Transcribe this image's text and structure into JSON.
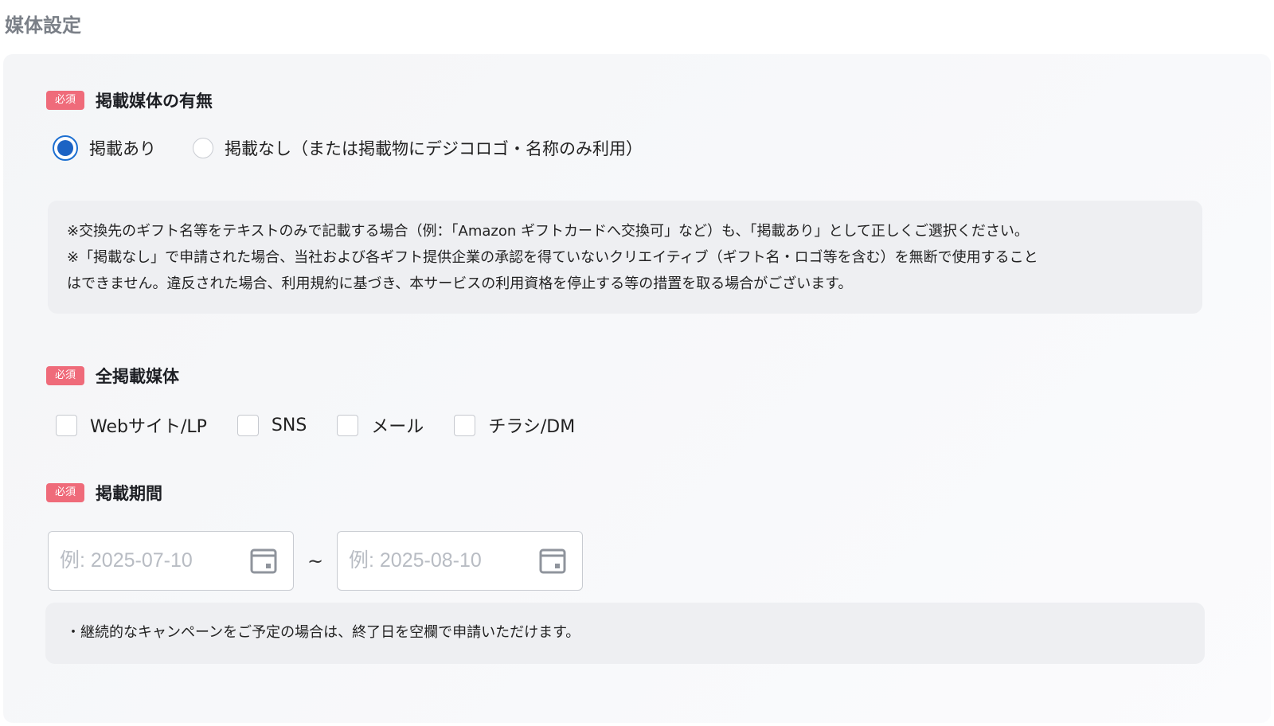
{
  "page_title": "媒体設定",
  "required_badge": "必須",
  "section_media_presence": {
    "title": "掲載媒体の有無",
    "options": [
      {
        "label": "掲載あり",
        "checked": true
      },
      {
        "label": "掲載なし（または掲載物にデジコロゴ・名称のみ利用）",
        "checked": false
      }
    ],
    "notes": [
      "※交換先のギフト名等をテキストのみで記載する場合（例：「Amazon ギフトカードへ交換可」など）も、「掲載あり」として正しくご選択ください。",
      "※「掲載なし」で申請された場合、当社および各ギフト提供企業の承認を得ていないクリエイティブ（ギフト名・ロゴ等を含む）を無断で使用すること",
      "はできません。違反された場合、利用規約に基づき、本サービスの利用資格を停止する等の措置を取る場合がございます。"
    ]
  },
  "section_all_media": {
    "title": "全掲載媒体",
    "options": [
      {
        "label": "Webサイト/LP",
        "checked": false
      },
      {
        "label": "SNS",
        "checked": false
      },
      {
        "label": "メール",
        "checked": false
      },
      {
        "label": "チラシ/DM",
        "checked": false
      }
    ]
  },
  "section_period": {
    "title": "掲載期間",
    "start_placeholder": "例: 2025-07-10",
    "end_placeholder": "例: 2025-08-10",
    "separator": "~",
    "note": "・継続的なキャンペーンをご予定の場合は、終了日を空欄で申請いただけます。"
  },
  "colors": {
    "accent": "#1c63c4",
    "required_badge": "#ef6b7a",
    "card_background": "#f5f6f8",
    "note_background": "#eeeff2",
    "title_gray": "#7a7f87"
  },
  "icons": [
    "calendar-icon"
  ]
}
